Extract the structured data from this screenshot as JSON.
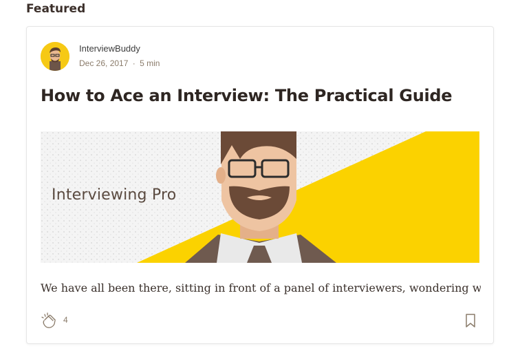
{
  "section": {
    "title": "Featured"
  },
  "post": {
    "author": "InterviewBuddy",
    "date": "Dec 26, 2017",
    "separator": "·",
    "read_time": "5 min",
    "title": "How to Ace an Interview: The Practical Guide",
    "hero_text": "Interviewing Pro",
    "excerpt": "We have all been there, sitting in front of a panel of interviewers, wondering why…",
    "claps": "4"
  },
  "icons": {
    "avatar": "avatar-illustration",
    "clap": "clap-icon",
    "bookmark": "bookmark-icon"
  },
  "colors": {
    "accent_yellow": "#fbd200",
    "text_dark": "#2e2622",
    "meta": "#8a7b6a"
  }
}
